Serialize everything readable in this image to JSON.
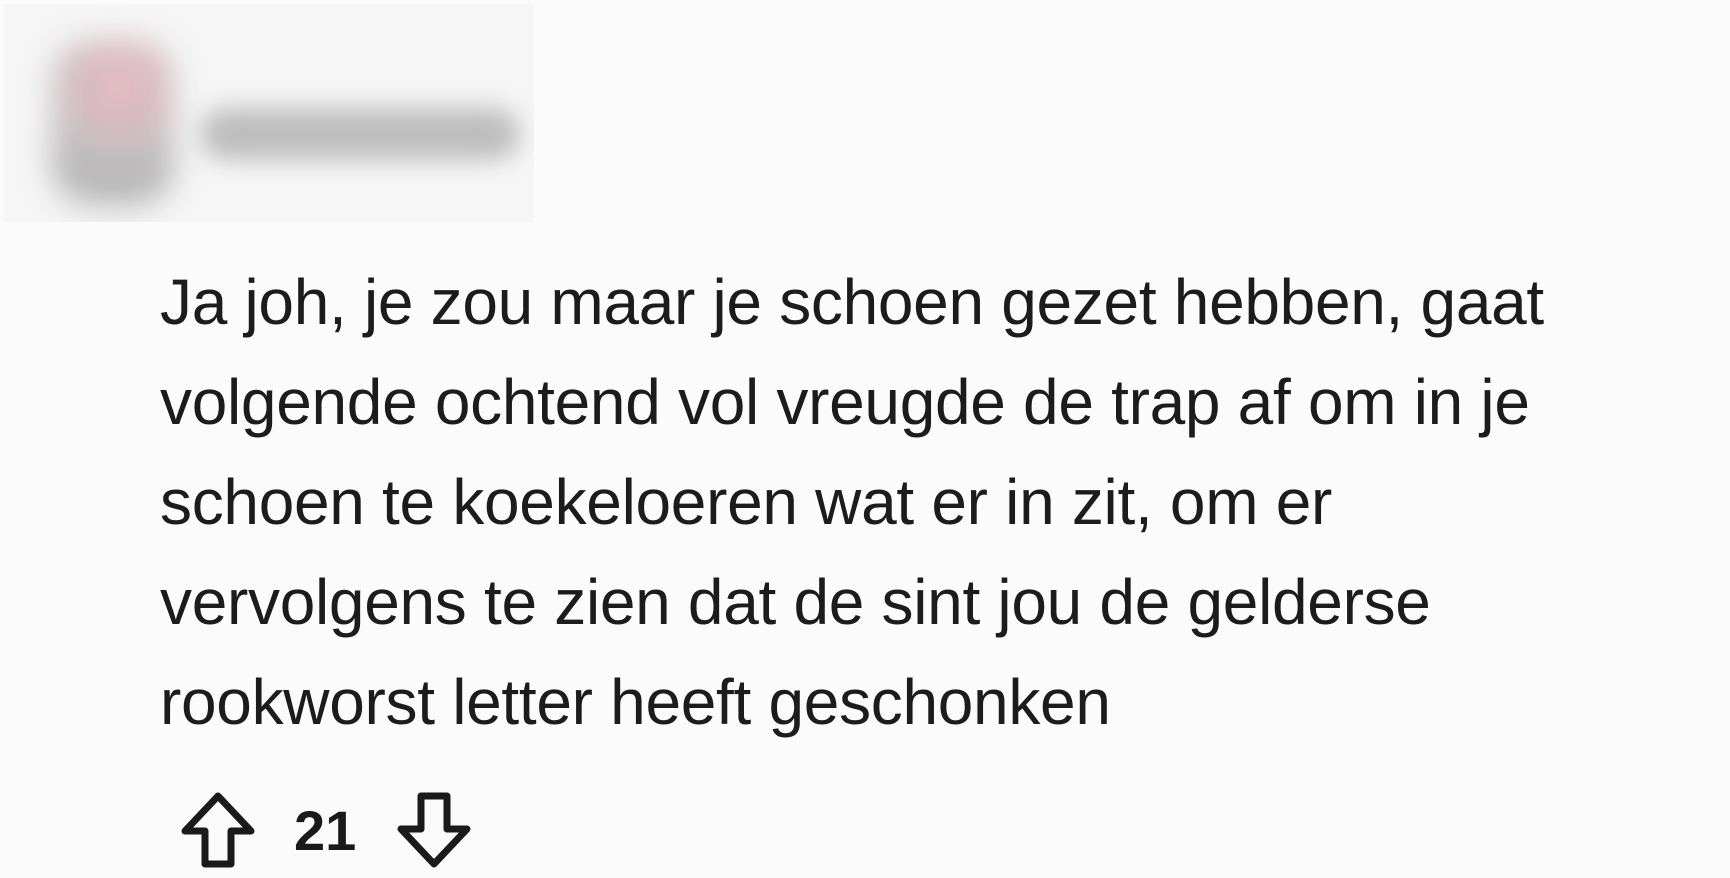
{
  "comment": {
    "body_lines": [
      "Ja joh, je zou maar je schoen gezet hebben, gaat",
      "volgende ochtend vol vreugde de trap af om in je",
      "schoen te koekeloeren wat er in zit, om er",
      "vervolgens te zien dat de sint jou de gelderse",
      "rookworst letter heeft geschonken"
    ],
    "score": "21",
    "icons": {
      "upvote": "arrow-up-outline-icon",
      "downvote": "arrow-down-outline-icon"
    }
  },
  "colors": {
    "background": "#fbfbfb",
    "text": "#1c1c1c"
  }
}
